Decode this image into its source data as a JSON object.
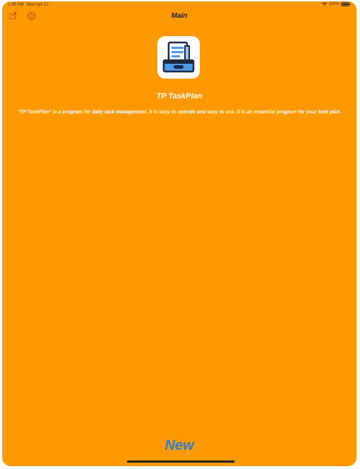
{
  "status_bar": {
    "time": "2:06 PM",
    "date": "Mon Apr 17",
    "battery": "100%"
  },
  "nav": {
    "title": "Main",
    "left_icons": [
      "share-icon",
      "gear-icon"
    ]
  },
  "app": {
    "icon": "task-plan-app-icon",
    "name": "TP TaskPlan",
    "description": "\"TP TaskPlan\" is a program for daily task management. It is easy to operate and easy to use. It is an essential program for your task plan."
  },
  "actions": {
    "new_label": "New"
  },
  "colors": {
    "background": "#ff9900",
    "accent": "#2a7fd6",
    "text": "#ffffff"
  }
}
